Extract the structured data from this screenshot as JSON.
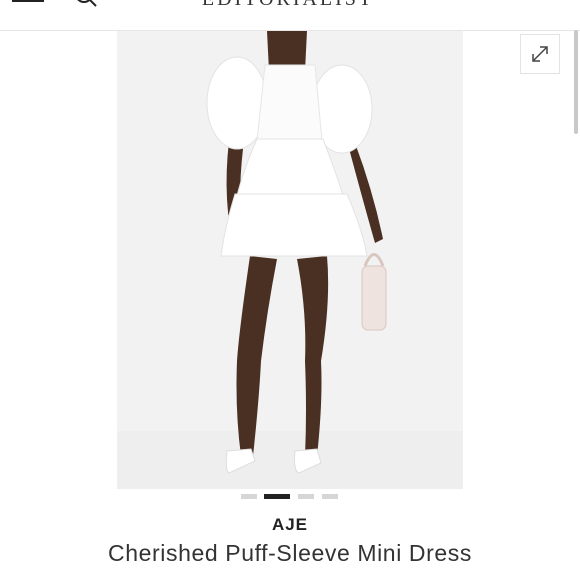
{
  "header": {
    "logo_text": "EDITORIALIST",
    "menu_icon": "menu-icon",
    "search_icon": "search-icon",
    "bag_icon": "shopping-bag-icon"
  },
  "gallery": {
    "expand_icon": "expand-icon",
    "slide_count": 4,
    "active_slide": 2,
    "background_color": "#f2f2f2"
  },
  "product": {
    "brand": "AJE",
    "name": "Cherished Puff-Sleeve Mini Dress"
  }
}
